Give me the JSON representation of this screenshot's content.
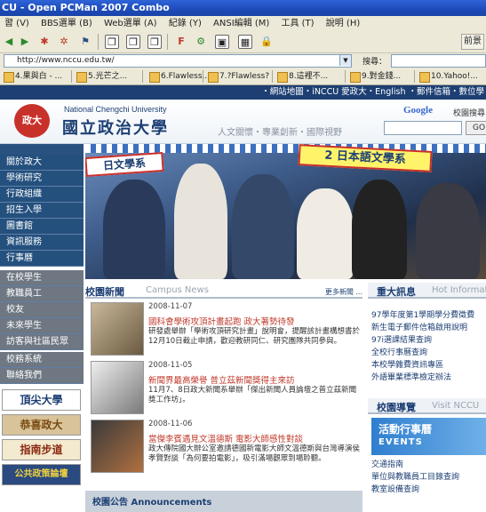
{
  "window": {
    "title": "CU - Open PCMan 2007 Combo"
  },
  "menu": [
    "習 (V)",
    "BBS選單 (B)",
    "Web選單 (A)",
    "紀錄 (Y)",
    "ANSI編輯 (M)",
    "工具 (T)",
    "說明 (H)"
  ],
  "toolbar": {
    "right_button": "前景"
  },
  "address": {
    "url": "http://www.nccu.edu.tw/",
    "search_label": "搜尋："
  },
  "favorites": [
    "4.果與白 - ...",
    "5.光芒之...",
    "6.Flawless...",
    "7.?Flawless?",
    "8.這裡不...",
    "9.對金錢...",
    "10.Yahoo!..."
  ],
  "site": {
    "topnav": "・網站地圖・iNCCU 愛政大・English ・郵件信箱・數位學",
    "seal_text": "政大",
    "name_en": "National Chengchi University",
    "name_zh": "國立政治大學",
    "slogan": "人文關懷・專業創新・國際視野",
    "google_logo": "Google",
    "google_label": "校園搜尋",
    "google_button": "GO"
  },
  "sidebar": {
    "items": [
      "關於政大",
      "學術研究",
      "行政組織",
      "招生入學",
      "圖書館",
      "資訊服務",
      "行事曆",
      "在校學生",
      "教職員工",
      "校友",
      "未來學生",
      "訪客與社區民眾",
      "校務系統",
      "聯絡我們"
    ],
    "banners": [
      "頂尖大學",
      "恭喜政大",
      "指南步道",
      "公共政策論壇"
    ]
  },
  "hero": {
    "sign_left": "日文學系",
    "sign_right": "2 日本語文學系"
  },
  "news": {
    "title_zh": "校園新聞",
    "title_en": "Campus News",
    "more": "更多新聞 ...",
    "items": [
      {
        "date": "2008-11-07",
        "title": "國科會學術攻頂計畫起跑 政大著勢待發",
        "body": "研發處舉辦「學術攻頂研究計畫」說明會，提醒該計畫構想書於12月10日截止申請，歡迎教研同仁、研究團隊共同參與。"
      },
      {
        "date": "2008-11-05",
        "title": "新聞界最高榮譽 普立茲新聞獎得主來訪",
        "body": "11月7、8日政大新聞系舉辦「傑出新聞人員論壇之普立茲新聞獎工作坊」。"
      },
      {
        "date": "2008-11-06",
        "title": "當傑李賓遇見文溫德斯 電影大師感性對談",
        "body": "政大傳院國大辦公室邀請德國新電影大師文溫德斯與台灣導演侯孝賢對談「為何要拍電影」，吸引滿場觀眾到場聆聽。"
      }
    ],
    "announcements_label": "校園公告 Announcements"
  },
  "important": {
    "title_zh": "重大訊息",
    "title_en": "Hot Information",
    "items": [
      "97學年度第1學期學分費徵費",
      "新生電子郵件信箱啟用說明",
      "97i選課結果查詢",
      "全校行事曆查詢",
      "本校學雜費資訊專區",
      "外語畢業標準檢定辦法"
    ]
  },
  "guide": {
    "title_zh": "校園導覽",
    "title_en": "Visit NCCU",
    "events_zh": "活動行事曆",
    "events_en": "EVENTS",
    "items": [
      "交通指南",
      "單位與教職員工目錄查詢",
      "教室設備查詢"
    ]
  }
}
